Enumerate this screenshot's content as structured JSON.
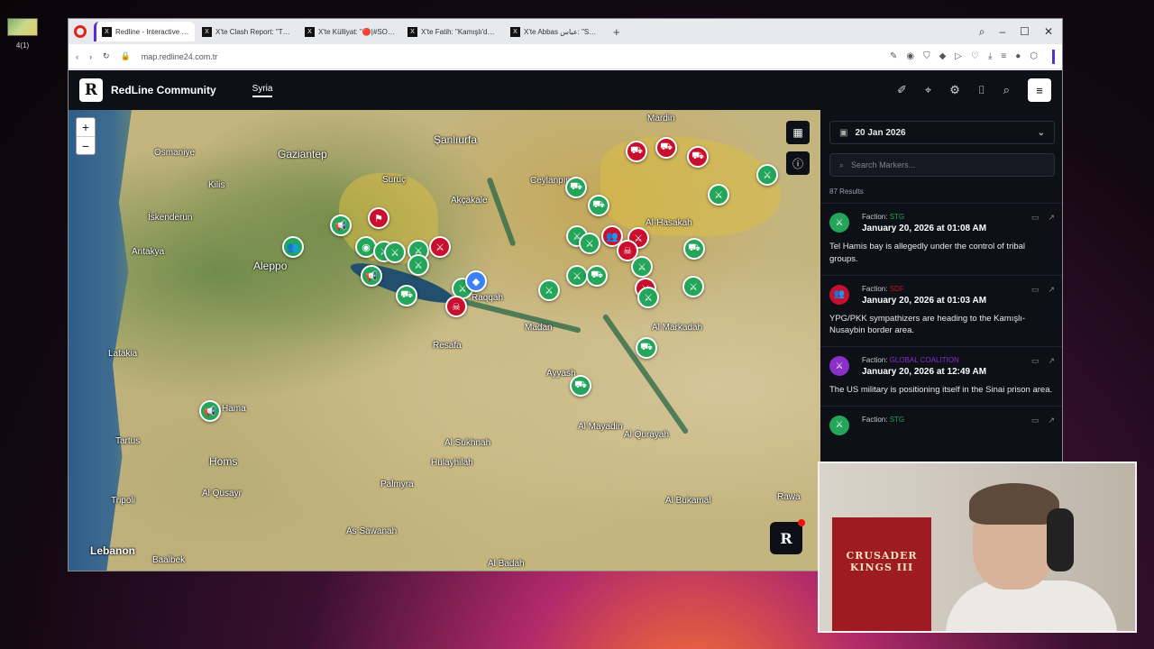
{
  "desktop": {
    "icon_label": "4(1)"
  },
  "browser": {
    "tabs": [
      {
        "label": "Redline - Interactive Strat",
        "active": true
      },
      {
        "label": "X'te Clash Report: \"The Sy",
        "active": false
      },
      {
        "label": "X'te Külliyat: \"🔴|#SONDA",
        "active": false
      },
      {
        "label": "X'te Fatih: \"Kamışlı'da top",
        "active": false
      },
      {
        "label": "X'te Abbas عباس: \"SDF's w",
        "active": false
      }
    ],
    "new_tab": "+",
    "url": "map.redline24.com.tr"
  },
  "app": {
    "brand": "RedLine Community",
    "logo": "R",
    "region_tab": "Syria"
  },
  "map": {
    "zoom_in": "+",
    "zoom_out": "−",
    "cities": [
      {
        "name": "Mardin",
        "cls": ""
      },
      {
        "name": "Gaziantep",
        "cls": "big"
      },
      {
        "name": "Osmaniye",
        "cls": ""
      },
      {
        "name": "Şanlıurfa",
        "cls": "big"
      },
      {
        "name": "İskenderun",
        "cls": ""
      },
      {
        "name": "Antakya",
        "cls": ""
      },
      {
        "name": "Aleppo",
        "cls": "big"
      },
      {
        "name": "Raqqah",
        "cls": ""
      },
      {
        "name": "Latakia",
        "cls": ""
      },
      {
        "name": "Hama",
        "cls": ""
      },
      {
        "name": "Homs",
        "cls": "big"
      },
      {
        "name": "Tartus",
        "cls": ""
      },
      {
        "name": "Tripoli",
        "cls": ""
      },
      {
        "name": "Lebanon",
        "cls": "country"
      },
      {
        "name": "Palmyra",
        "cls": ""
      },
      {
        "name": "Resafa",
        "cls": ""
      },
      {
        "name": "Ayyash",
        "cls": ""
      },
      {
        "name": "Al Mayadin",
        "cls": ""
      },
      {
        "name": "Al Qurayah",
        "cls": ""
      },
      {
        "name": "Madan",
        "cls": ""
      },
      {
        "name": "Al-Hasakah",
        "cls": ""
      },
      {
        "name": "Al Markadah",
        "cls": ""
      },
      {
        "name": "Al Bukamal",
        "cls": ""
      },
      {
        "name": "Rawa",
        "cls": ""
      },
      {
        "name": "Kilis",
        "cls": ""
      },
      {
        "name": "Suruç",
        "cls": ""
      },
      {
        "name": "Akçakale",
        "cls": ""
      },
      {
        "name": "Ceylanpınar",
        "cls": ""
      },
      {
        "name": "Al Sukhnah",
        "cls": ""
      },
      {
        "name": "Hulayhilah",
        "cls": ""
      },
      {
        "name": "Al Qusayr",
        "cls": ""
      },
      {
        "name": "As Sawanah",
        "cls": ""
      },
      {
        "name": "Al Badah",
        "cls": ""
      },
      {
        "name": "Baalbek",
        "cls": ""
      }
    ],
    "badge": "R"
  },
  "sidebar": {
    "date": "20 Jan 2026",
    "search_placeholder": "Search Markers...",
    "results": "87 Results",
    "items": [
      {
        "faction_label": "Faction:",
        "faction": "STG",
        "faction_color": "#23a55a",
        "date": "January 20, 2026 at 01:08 AM",
        "text": "Tel Hamis bay is allegedly under the control of tribal groups.",
        "icon_color": "#23a55a",
        "icon": "⚔"
      },
      {
        "faction_label": "Faction:",
        "faction": "SDF",
        "faction_color": "#c8102e",
        "date": "January 20, 2026 at 01:03 AM",
        "text": "YPG/PKK sympathizers are heading to the Kamışlı-Nusaybin border area.",
        "icon_color": "#c8102e",
        "icon": "👥"
      },
      {
        "faction_label": "Faction:",
        "faction": "GLOBAL COALITION",
        "faction_color": "#8b2fc9",
        "date": "January 20, 2026 at 12:49 AM",
        "text": "The US military is positioning itself in the Sinai prison area.",
        "icon_color": "#8b2fc9",
        "icon": "⚔"
      },
      {
        "faction_label": "Faction:",
        "faction": "STG",
        "faction_color": "#23a55a",
        "date": "",
        "text": "",
        "icon_color": "#23a55a",
        "icon": "⚔"
      }
    ]
  },
  "webcam": {
    "banner_text": "CRUSADER KINGS III"
  }
}
